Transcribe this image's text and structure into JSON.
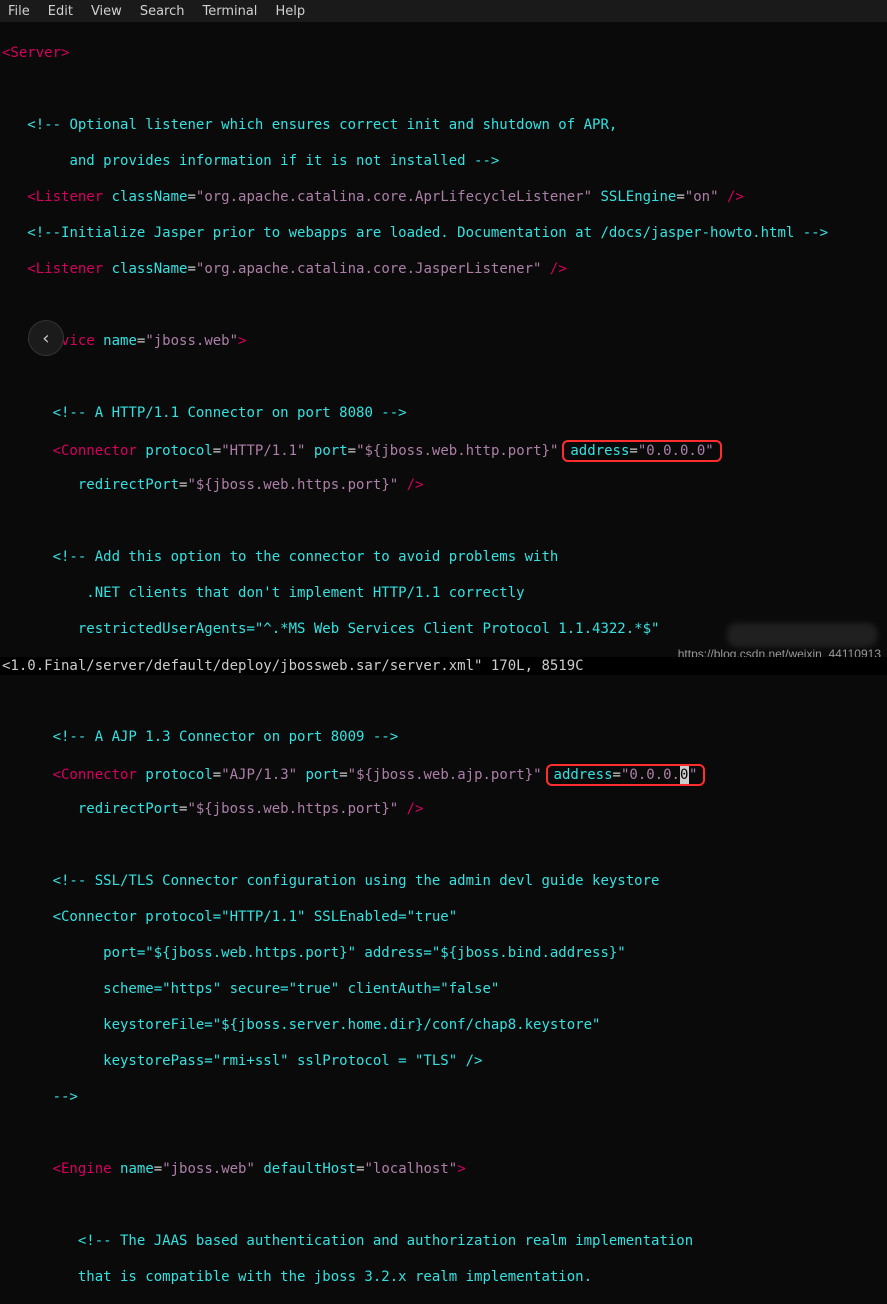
{
  "menu": {
    "items": [
      "File",
      "Edit",
      "View",
      "Search",
      "Terminal",
      "Help"
    ]
  },
  "code": {
    "server_open": "<Server>",
    "lst1_cmt1": "<!-- Optional listener which ensures correct init and shutdown of APR,",
    "lst1_cmt2": "     and provides information if it is not installed -->",
    "listener1": {
      "tag": "<Listener",
      "cn_attr": "className",
      "cn_val": "\"org.apache.catalina.core.AprLifecycleListener\"",
      "ssl_attr": "SSLEngine",
      "ssl_val": "\"on\"",
      "close": "/>"
    },
    "jasper_cmt": "<!--Initialize Jasper prior to webapps are loaded. Documentation at /docs/jasper-howto.html -->",
    "listener2": {
      "tag": "<Listener",
      "cn_attr": "className",
      "cn_val": "\"org.apache.catalina.core.JasperListener\"",
      "close": "/>"
    },
    "service": {
      "tag": "<Service",
      "name_attr": "name",
      "name_val": "\"jboss.web\"",
      "gt": ">"
    },
    "http_cmt": "<!-- A HTTP/1.1 Connector on port 8080 -->",
    "conn1": {
      "tag": "<Connector",
      "proto_attr": "protocol",
      "proto_val": "\"HTTP/1.1\"",
      "port_attr": "port",
      "port_val": "\"${jboss.web.http.port}\"",
      "addr_attr": "address",
      "addr_val": "\"0.0.0.0\"",
      "redir_attr": "redirectPort",
      "redir_val": "\"${jboss.web.https.port}\"",
      "close": "/>"
    },
    "opt_cmt1": "<!-- Add this option to the connector to avoid problems with",
    "opt_cmt2": "    .NET clients that don't implement HTTP/1.1 correctly",
    "opt_cmt3": "   restrictedUserAgents=\"^.*MS Web Services Client Protocol 1.1.4322.*$\"",
    "opt_cmt4": "-->",
    "ajp_cmt": "<!-- A AJP 1.3 Connector on port 8009 -->",
    "conn2": {
      "tag": "<Connector",
      "proto_attr": "protocol",
      "proto_val": "\"AJP/1.3\"",
      "port_attr": "port",
      "port_val": "\"${jboss.web.ajp.port}\"",
      "addr_attr": "address",
      "addr_val_head": "\"0.0.0.",
      "addr_val_cursor": "0",
      "addr_val_tail": "\"",
      "redir_attr": "redirectPort",
      "redir_val": "\"${jboss.web.https.port}\"",
      "close": "/>"
    },
    "ssl_cmt1": "<!-- SSL/TLS Connector configuration using the admin devl guide keystore",
    "ssl_cmt2": "<Connector protocol=\"HTTP/1.1\" SSLEnabled=\"true\"",
    "ssl_cmt3": "   port=\"${jboss.web.https.port}\" address=\"${jboss.bind.address}\"",
    "ssl_cmt4": "   scheme=\"https\" secure=\"true\" clientAuth=\"false\"",
    "ssl_cmt5": "   keystoreFile=\"${jboss.server.home.dir}/conf/chap8.keystore\"",
    "ssl_cmt6": "   keystorePass=\"rmi+ssl\" sslProtocol = \"TLS\" />",
    "ssl_cmt7": "-->",
    "engine": {
      "tag": "<Engine",
      "name_attr": "name",
      "name_val": "\"jboss.web\"",
      "dh_attr": "defaultHost",
      "dh_val": "\"localhost\"",
      "gt": ">"
    },
    "jaas_cmt1": "<!-- The JAAS based authentication and authorization realm implementation",
    "jaas_cmt2": "that is compatible with the jboss 3.2.x realm implementation."
  },
  "status": "<1.0.Final/server/default/deploy/jbossweb.sar/server.xml\" 170L, 8519C",
  "watermark": "https://blog.csdn.net/weixin_44110913",
  "nav_glyph": "‹"
}
